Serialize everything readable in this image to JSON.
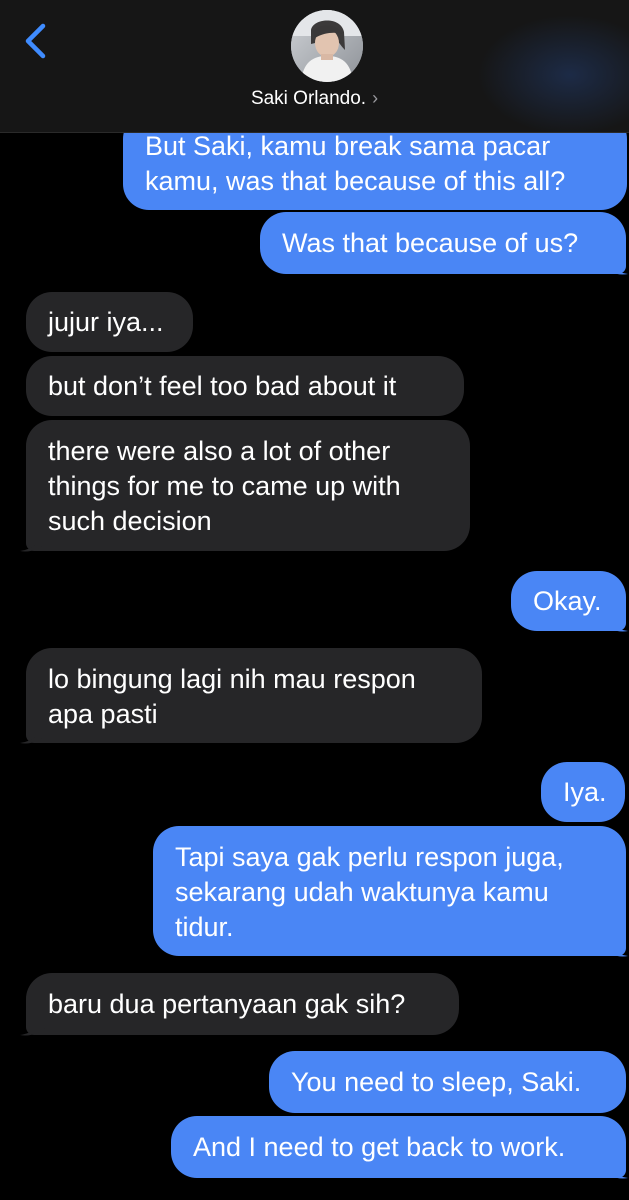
{
  "header": {
    "contact_name": "Saki Orlando.",
    "chevron": "›",
    "back_icon": "chevron-left-icon",
    "accent_color": "#3f8cff"
  },
  "colors": {
    "outgoing": "#4a86f5",
    "incoming": "#262628",
    "background": "#000000"
  },
  "messages": [
    {
      "side": "out",
      "text": "But Saki, kamu break sama pacar kamu, was that because of this all?"
    },
    {
      "side": "out",
      "text": "Was that because of us?"
    },
    {
      "side": "in",
      "text": "jujur iya..."
    },
    {
      "side": "in",
      "text": "but don’t feel too bad about it"
    },
    {
      "side": "in",
      "text": "there were also a lot of other things for me to came up with such decision"
    },
    {
      "side": "out",
      "text": "Okay."
    },
    {
      "side": "in",
      "text": "lo bingung lagi nih mau respon apa pasti"
    },
    {
      "side": "out",
      "text": "Iya."
    },
    {
      "side": "out",
      "text": "Tapi saya gak perlu respon juga, sekarang udah waktunya kamu tidur."
    },
    {
      "side": "in",
      "text": "baru dua pertanyaan gak sih?"
    },
    {
      "side": "out",
      "text": "You need to sleep, Saki."
    },
    {
      "side": "out",
      "text": "And I need to get back to work."
    }
  ]
}
